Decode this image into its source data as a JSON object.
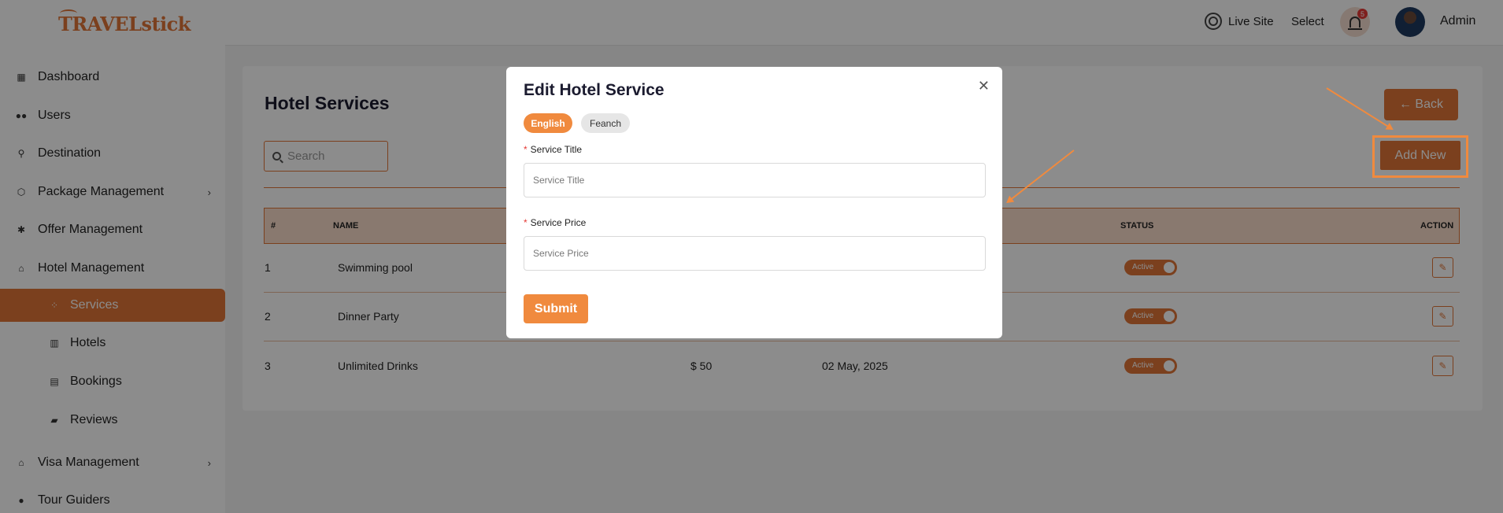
{
  "brand": {
    "logo_text": "TRAVELstick"
  },
  "topbar": {
    "live_site": "Live Site",
    "select": "Select",
    "notification_count": "5",
    "user_name": "Admin"
  },
  "sidebar": {
    "items": [
      {
        "label": "Dashboard",
        "icon": "dashboard-icon"
      },
      {
        "label": "Users",
        "icon": "users-icon"
      },
      {
        "label": "Destination",
        "icon": "destination-icon"
      },
      {
        "label": "Package Management",
        "icon": "package-icon",
        "chevron": "›"
      },
      {
        "label": "Offer Management",
        "icon": "offer-icon"
      },
      {
        "label": "Hotel Management",
        "icon": "hotel-icon"
      },
      {
        "label": "Services",
        "icon": "services-icon",
        "active": true
      },
      {
        "label": "Hotels",
        "icon": "hotels-icon"
      },
      {
        "label": "Bookings",
        "icon": "bookings-icon"
      },
      {
        "label": "Reviews",
        "icon": "reviews-icon"
      },
      {
        "label": "Visa Management",
        "icon": "visa-icon",
        "chevron": "›"
      },
      {
        "label": "Tour Guiders",
        "icon": "tour-guiders-icon"
      }
    ]
  },
  "main": {
    "title": "Hotel Services",
    "back_label": "← Back",
    "add_label": "Add New",
    "search_placeholder": "Search",
    "table": {
      "headers": {
        "index": "#",
        "name": "NAME",
        "status": "STATUS",
        "action": "ACTION"
      },
      "rows": [
        {
          "index": "1",
          "name": "Swimming pool",
          "price": "",
          "date": "",
          "status": "Active"
        },
        {
          "index": "2",
          "name": "Dinner Party",
          "price": "",
          "date": "",
          "status": "Active"
        },
        {
          "index": "3",
          "name": "Unlimited Drinks",
          "price": "$ 50",
          "date": "02 May, 2025",
          "status": "Active"
        }
      ]
    }
  },
  "modal": {
    "title": "Edit Hotel Service",
    "close": "✕",
    "languages": [
      "English",
      "Feanch"
    ],
    "fields": [
      {
        "label": "Service Title",
        "placeholder": "Service Title",
        "required_mark": "*"
      },
      {
        "label": "Service Price",
        "placeholder": "Service Price",
        "required_mark": "*"
      }
    ],
    "submit_label": "Submit"
  },
  "colors": {
    "accent": "#e07638",
    "accent_light": "#f08a3e",
    "header_bg": "#f9dccb",
    "overlay": "rgba(0,0,0,0.45)"
  }
}
